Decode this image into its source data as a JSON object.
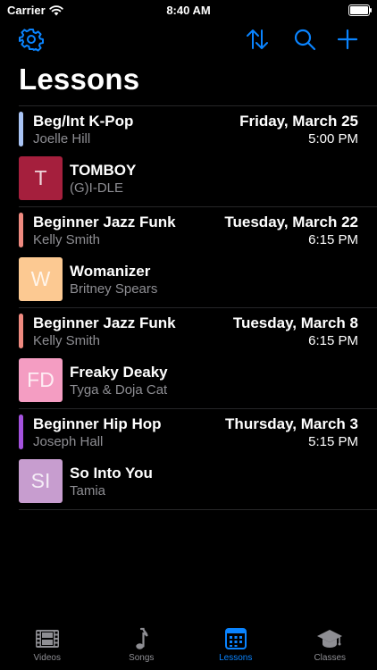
{
  "status_bar": {
    "carrier": "Carrier",
    "time": "8:40 AM"
  },
  "nav": {
    "icons": [
      "gear-icon",
      "sort-arrows-icon",
      "search-icon",
      "plus-icon"
    ],
    "accent_color": "#0a84ff"
  },
  "page": {
    "title": "Lessons"
  },
  "lessons": [
    {
      "class_name": "Beg/Int K-Pop",
      "instructor": "Joelle Hill",
      "date": "Friday, March 25",
      "time": "5:00 PM",
      "color": "#a9c4f5",
      "song": {
        "initials": "T",
        "title": "TOMBOY",
        "artist": "(G)I-DLE",
        "art_color": "#a51f3d"
      }
    },
    {
      "class_name": "Beginner Jazz Funk",
      "instructor": "Kelly Smith",
      "date": "Tuesday, March 22",
      "time": "6:15 PM",
      "color": "#ef8a80",
      "song": {
        "initials": "W",
        "title": "Womanizer",
        "artist": "Britney Spears",
        "art_color": "#fcc992"
      }
    },
    {
      "class_name": "Beginner Jazz Funk",
      "instructor": "Kelly Smith",
      "date": "Tuesday, March 8",
      "time": "6:15 PM",
      "color": "#ef8a80",
      "song": {
        "initials": "FD",
        "title": "Freaky Deaky",
        "artist": "Tyga & Doja Cat",
        "art_color": "#f49dc2"
      }
    },
    {
      "class_name": "Beginner Hip Hop",
      "instructor": "Joseph Hall",
      "date": "Thursday, March 3",
      "time": "5:15 PM",
      "color": "#a452de",
      "song": {
        "initials": "SI",
        "title": "So Into You",
        "artist": "Tamia",
        "art_color": "#c79dcf"
      }
    }
  ],
  "tab_bar": {
    "tabs": [
      {
        "label": "Videos",
        "icon": "film-icon",
        "active": false
      },
      {
        "label": "Songs",
        "icon": "music-note-icon",
        "active": false
      },
      {
        "label": "Lessons",
        "icon": "calendar-icon",
        "active": true
      },
      {
        "label": "Classes",
        "icon": "graduation-cap-icon",
        "active": false
      }
    ]
  }
}
